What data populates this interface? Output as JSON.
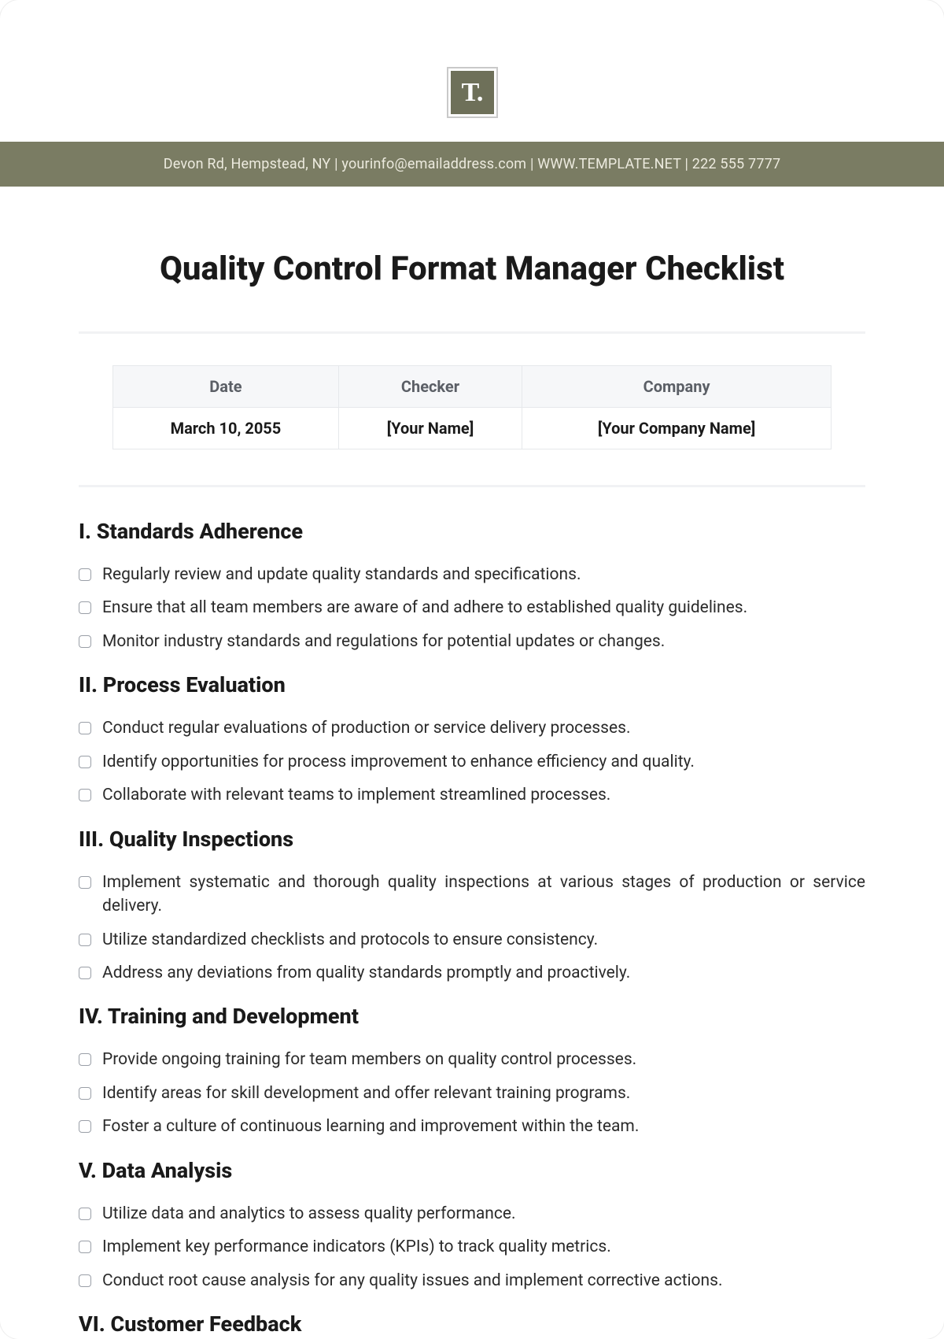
{
  "logo_text": "T.",
  "contact_bar": "Devon Rd, Hempstead, NY | yourinfo@emailaddress.com | WWW.TEMPLATE.NET | 222 555 7777",
  "title": "Quality Control Format Manager Checklist",
  "info_table": {
    "headers": [
      "Date",
      "Checker",
      "Company"
    ],
    "values": [
      "March 10, 2055",
      "[Your Name]",
      "[Your Company Name]"
    ]
  },
  "sections": [
    {
      "heading": "I. Standards Adherence",
      "items": [
        "Regularly review and update quality standards and specifications.",
        "Ensure that all team members are aware of and adhere to established quality guidelines.",
        "Monitor industry standards and regulations for potential updates or changes."
      ]
    },
    {
      "heading": "II. Process Evaluation",
      "items": [
        "Conduct regular evaluations of production or service delivery processes.",
        "Identify opportunities for process improvement to enhance efficiency and quality.",
        "Collaborate with relevant teams to implement streamlined processes."
      ]
    },
    {
      "heading": "III. Quality Inspections",
      "items": [
        "Implement systematic and thorough quality inspections at various stages of production or service delivery.",
        "Utilize standardized checklists and protocols to ensure consistency.",
        "Address any deviations from quality standards promptly and proactively."
      ]
    },
    {
      "heading": "IV. Training and Development",
      "items": [
        "Provide ongoing training for team members on quality control processes.",
        "Identify areas for skill development and offer relevant training programs.",
        "Foster a culture of continuous learning and improvement within the team."
      ]
    },
    {
      "heading": "V. Data Analysis",
      "items": [
        "Utilize data and analytics to assess quality performance.",
        "Implement key performance indicators (KPIs) to track quality metrics.",
        "Conduct root cause analysis for any quality issues and implement corrective actions."
      ]
    },
    {
      "heading": "VI. Customer Feedback",
      "items": []
    }
  ]
}
